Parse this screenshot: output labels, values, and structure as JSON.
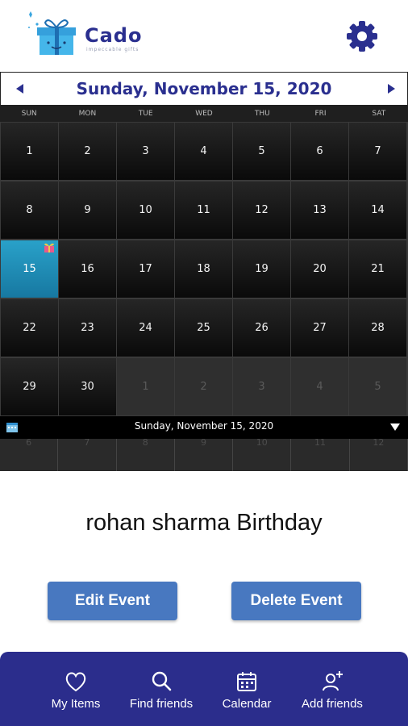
{
  "app": {
    "name": "Cado",
    "tagline": "impeccable gifts"
  },
  "calendar": {
    "title": "Sunday, November 15, 2020",
    "weekdays": [
      "SUN",
      "MON",
      "TUE",
      "WED",
      "THU",
      "FRI",
      "SAT"
    ],
    "weeks": [
      [
        "1",
        "2",
        "3",
        "4",
        "5",
        "6",
        "7"
      ],
      [
        "8",
        "9",
        "10",
        "11",
        "12",
        "13",
        "14"
      ],
      [
        "15",
        "16",
        "17",
        "18",
        "19",
        "20",
        "21"
      ],
      [
        "22",
        "23",
        "24",
        "25",
        "26",
        "27",
        "28"
      ],
      [
        "29",
        "30",
        "1",
        "2",
        "3",
        "4",
        "5"
      ]
    ],
    "selected_date": "15",
    "footer_date": "Sunday, November 15, 2020",
    "mini_row": [
      "6",
      "7",
      "8",
      "9",
      "10",
      "11",
      "12"
    ]
  },
  "event": {
    "title": "rohan sharma Birthday"
  },
  "buttons": {
    "edit": "Edit Event",
    "delete": "Delete Event"
  },
  "nav": {
    "items": [
      {
        "label": "My Items",
        "icon": "heart-icon"
      },
      {
        "label": "Find friends",
        "icon": "search-icon"
      },
      {
        "label": "Calendar",
        "icon": "calendar-icon"
      },
      {
        "label": "Add friends",
        "icon": "add-user-icon"
      }
    ]
  },
  "colors": {
    "brand": "#2a2f8f",
    "selected": "#1f8fb8",
    "button": "#4878c0",
    "nav_bg": "#2b2d8c"
  }
}
